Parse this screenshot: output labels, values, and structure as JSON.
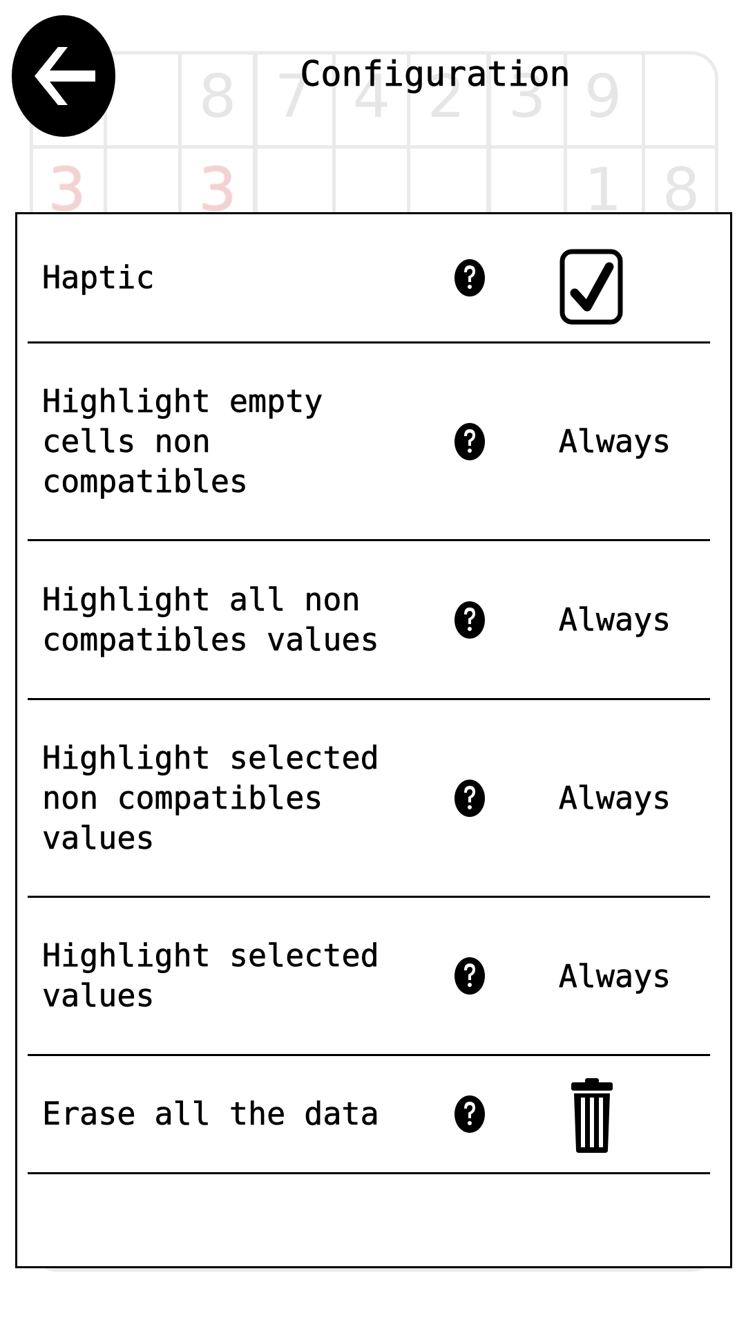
{
  "header": {
    "title": "Configuration",
    "back_icon": "arrow-left-icon"
  },
  "background_board": {
    "row1": [
      "",
      "",
      "8",
      "7",
      "4",
      "2",
      "3",
      "9",
      ""
    ],
    "row2": [
      "3",
      "",
      "3",
      "",
      "",
      "",
      "",
      "1",
      "8"
    ],
    "conflict_color": "#f3d2d2"
  },
  "settings": [
    {
      "label": "Haptic",
      "control": "checkbox",
      "checked": true
    },
    {
      "label": "Highlight empty\ncells non\ncompatibles",
      "value": "Always"
    },
    {
      "label": "Highlight all non\ncompatibles values",
      "value": "Always"
    },
    {
      "label": "Highlight selected\nnon compatibles\nvalues",
      "value": "Always"
    },
    {
      "label": "Highlight selected\nvalues",
      "value": "Always"
    },
    {
      "label": "Erase all the data",
      "control": "trash-icon"
    }
  ]
}
